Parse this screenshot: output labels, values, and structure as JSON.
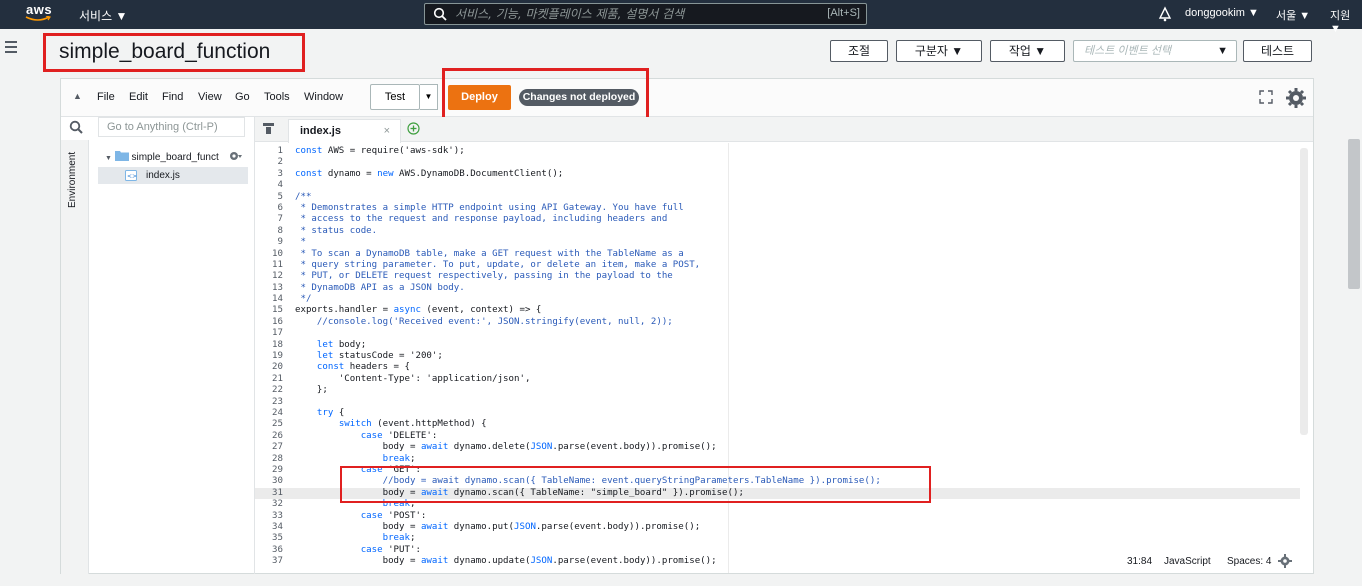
{
  "topnav": {
    "logo_text": "aws",
    "services_label": "서비스 ▼",
    "search_placeholder": "서비스, 기능, 마켓플레이스 제품, 설명서 검색",
    "search_shortcut": "[Alt+S]",
    "user_label": "donggookim ▼",
    "region_label": "서울 ▼",
    "support_label": "지원 ▼"
  },
  "header": {
    "function_name": "simple_board_function",
    "throttle_label": "조절",
    "qualifiers_label": "구분자 ▼",
    "actions_label": "작업 ▼",
    "test_event_placeholder": "테스트 이벤트 선택",
    "test_label": "테스트"
  },
  "toolbar": {
    "menus": [
      "File",
      "Edit",
      "Find",
      "View",
      "Go",
      "Tools",
      "Window"
    ],
    "test_label": "Test",
    "deploy_label": "Deploy",
    "status_badge": "Changes not deployed"
  },
  "sidebar": {
    "goto_placeholder": "Go to Anything (Ctrl-P)",
    "env_label": "Environment",
    "folder_name": "simple_board_funct",
    "file_name": "index.js"
  },
  "tabs": [
    {
      "label": "index.js"
    }
  ],
  "editor": {
    "active_line": 31,
    "lines": [
      "const AWS = require('aws-sdk');",
      "",
      "const dynamo = new AWS.DynamoDB.DocumentClient();",
      "",
      "/**",
      " * Demonstrates a simple HTTP endpoint using API Gateway. You have full",
      " * access to the request and response payload, including headers and",
      " * status code.",
      " *",
      " * To scan a DynamoDB table, make a GET request with the TableName as a",
      " * query string parameter. To put, update, or delete an item, make a POST,",
      " * PUT, or DELETE request respectively, passing in the payload to the",
      " * DynamoDB API as a JSON body.",
      " */",
      "exports.handler = async (event, context) => {",
      "    //console.log('Received event:', JSON.stringify(event, null, 2));",
      "",
      "    let body;",
      "    let statusCode = '200';",
      "    const headers = {",
      "        'Content-Type': 'application/json',",
      "    };",
      "",
      "    try {",
      "        switch (event.httpMethod) {",
      "            case 'DELETE':",
      "                body = await dynamo.delete(JSON.parse(event.body)).promise();",
      "                break;",
      "            case 'GET':",
      "                //body = await dynamo.scan({ TableName: event.queryStringParameters.TableName }).promise();",
      "                body = await dynamo.scan({ TableName: \"simple_board\" }).promise();",
      "                break;",
      "            case 'POST':",
      "                body = await dynamo.put(JSON.parse(event.body)).promise();",
      "                break;",
      "            case 'PUT':",
      "                body = await dynamo.update(JSON.parse(event.body)).promise();"
    ]
  },
  "statusbar": {
    "cursor": "31:84",
    "language": "JavaScript",
    "indent": "Spaces: 4"
  },
  "colors": {
    "nav_bg": "#232f3e",
    "deploy_orange": "#ec7211",
    "annotation_red": "#e02020",
    "badge_gray": "#545b64"
  }
}
